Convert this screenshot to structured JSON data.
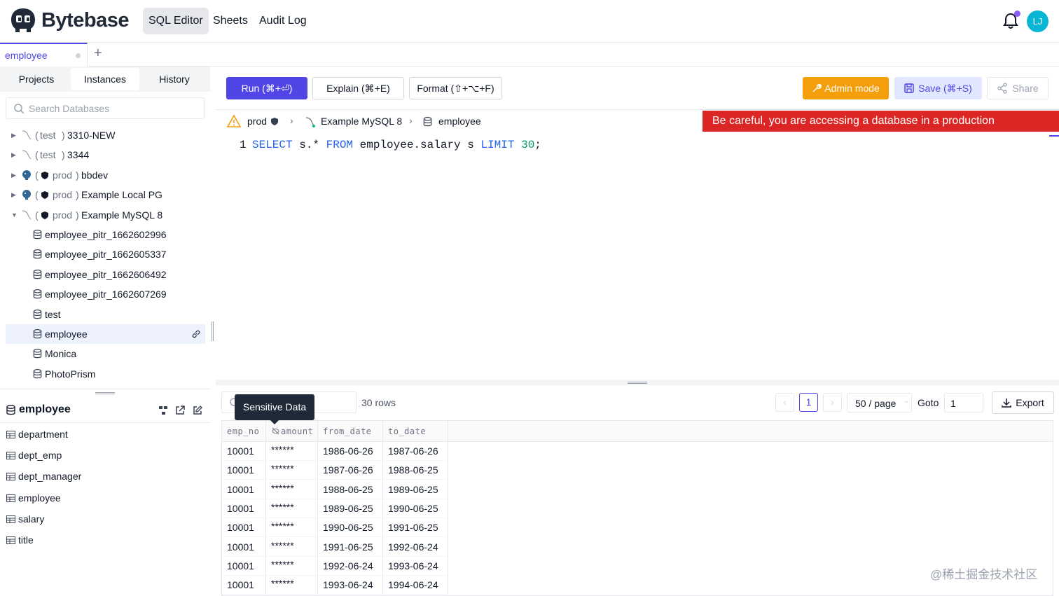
{
  "brand": {
    "name": "Bytebase"
  },
  "nav": {
    "items": [
      {
        "label": "SQL Editor",
        "active": true
      },
      {
        "label": "Sheets"
      },
      {
        "label": "Audit Log"
      }
    ]
  },
  "user": {
    "initials": "LJ",
    "avatar_color": "#06b6d4"
  },
  "colors": {
    "accent": "#4f46e5",
    "admin": "#f59e0b",
    "danger": "#dc2626"
  },
  "tabs": [
    {
      "label": "employee"
    }
  ],
  "sidebar": {
    "tabs": [
      "Projects",
      "Instances",
      "History"
    ],
    "search_placeholder": "Search Databases",
    "tree": [
      {
        "env": "test",
        "name": "3310-NEW",
        "paren_open": "(",
        "paren_close": ")"
      },
      {
        "env": "test",
        "name": "3344",
        "paren_open": "(",
        "paren_close": ")"
      },
      {
        "env": "prod",
        "name": "bbdev",
        "paren_open": "(",
        "paren_close": ")"
      },
      {
        "env": "prod",
        "name": "Example Local PG",
        "paren_open": "(",
        "paren_close": ")"
      },
      {
        "env": "prod",
        "name": "Example MySQL 8",
        "paren_open": "(",
        "paren_close": ")"
      }
    ],
    "databases": [
      "employee_pitr_1662602996",
      "employee_pitr_1662605337",
      "employee_pitr_1662606492",
      "employee_pitr_1662607269",
      "test",
      "employee",
      "Monica",
      "PhotoPrism"
    ],
    "selected_db": "employee",
    "table_panel": {
      "title": "employee",
      "tables": [
        "department",
        "dept_emp",
        "dept_manager",
        "employee",
        "salary",
        "title"
      ]
    }
  },
  "toolbar": {
    "run": "Run (⌘+⏎)",
    "explain": "Explain (⌘+E)",
    "format": "Format (⇧+⌥+F)",
    "admin": "Admin mode",
    "save": "Save (⌘+S)",
    "share": "Share"
  },
  "breadcrumb": {
    "env": "prod",
    "instance": "Example MySQL 8",
    "database": "employee"
  },
  "warning": "Be careful, you are accessing a database in a production environment.",
  "editor": {
    "line_no": "1",
    "tokens": [
      {
        "t": "SELECT",
        "c": "kw"
      },
      {
        "t": " s.* ",
        "c": "id"
      },
      {
        "t": "FROM",
        "c": "kw"
      },
      {
        "t": " employee.salary s ",
        "c": "id"
      },
      {
        "t": "LIMIT",
        "c": "kw"
      },
      {
        "t": " ",
        "c": "id"
      },
      {
        "t": "30",
        "c": "num"
      },
      {
        "t": ";",
        "c": "id"
      }
    ]
  },
  "results": {
    "tooltip": "Sensitive Data",
    "row_count": "30 rows",
    "page": "1",
    "page_size": "50 / page",
    "goto_label": "Goto",
    "goto_value": "1",
    "export": "Export",
    "columns": [
      "emp_no",
      "amount",
      "from_date",
      "to_date"
    ],
    "rows": [
      [
        "10001",
        "******",
        "1986-06-26",
        "1987-06-26"
      ],
      [
        "10001",
        "******",
        "1987-06-26",
        "1988-06-25"
      ],
      [
        "10001",
        "******",
        "1988-06-25",
        "1989-06-25"
      ],
      [
        "10001",
        "******",
        "1989-06-25",
        "1990-06-25"
      ],
      [
        "10001",
        "******",
        "1990-06-25",
        "1991-06-25"
      ],
      [
        "10001",
        "******",
        "1991-06-25",
        "1992-06-24"
      ],
      [
        "10001",
        "******",
        "1992-06-24",
        "1993-06-24"
      ],
      [
        "10001",
        "******",
        "1993-06-24",
        "1994-06-24"
      ]
    ]
  },
  "watermark": "@稀土掘金技术社区"
}
